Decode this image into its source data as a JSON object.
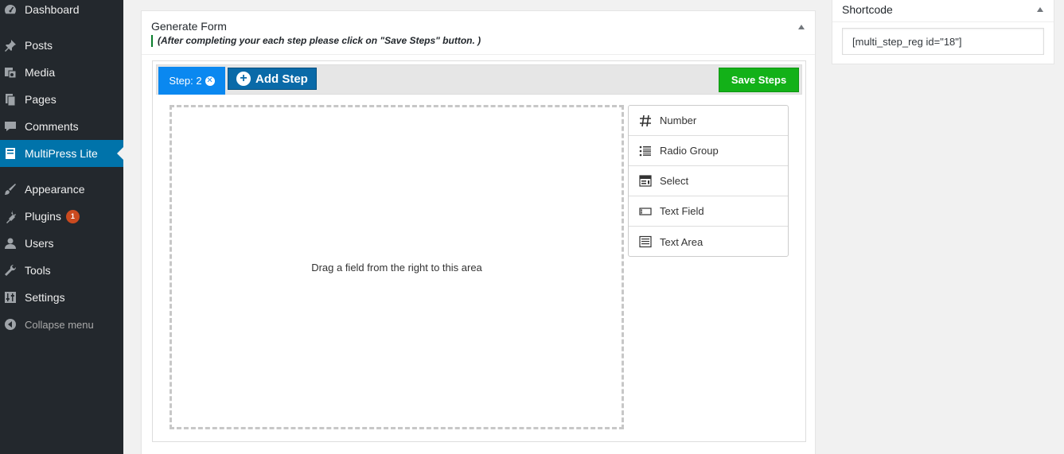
{
  "sidebar": {
    "items": [
      {
        "label": "Dashboard",
        "icon": "dashboard-icon"
      },
      {
        "label": "Posts",
        "icon": "pin-icon"
      },
      {
        "label": "Media",
        "icon": "media-icon"
      },
      {
        "label": "Pages",
        "icon": "pages-icon"
      },
      {
        "label": "Comments",
        "icon": "comment-icon"
      },
      {
        "label": "MultiPress Lite",
        "icon": "book-icon",
        "current": true
      },
      {
        "label": "Appearance",
        "icon": "brush-icon"
      },
      {
        "label": "Plugins",
        "icon": "plugin-icon",
        "badge": "1"
      },
      {
        "label": "Users",
        "icon": "user-icon"
      },
      {
        "label": "Tools",
        "icon": "wrench-icon"
      },
      {
        "label": "Settings",
        "icon": "sliders-icon"
      },
      {
        "label": "Collapse menu",
        "icon": "collapse-icon"
      }
    ]
  },
  "generate_form": {
    "title": "Generate Form",
    "note": "(After completing your each step please click on \"Save Steps\" button. )",
    "step_tab": "Step: 2",
    "add_step": "Add Step",
    "save_steps": "Save Steps",
    "dropzone_text": "Drag a field from the right to this area",
    "fields": [
      {
        "label": "Number",
        "icon": "hash-icon"
      },
      {
        "label": "Radio Group",
        "icon": "radio-group-icon"
      },
      {
        "label": "Select",
        "icon": "select-icon"
      },
      {
        "label": "Text Field",
        "icon": "text-field-icon"
      },
      {
        "label": "Text Area",
        "icon": "text-area-icon"
      }
    ]
  },
  "shortcode": {
    "title": "Shortcode",
    "value": "[multi_step_reg id=\"18\"]"
  },
  "colors": {
    "sidebar_bg": "#23282d",
    "current_menu": "#0073aa",
    "step_tab": "#0a88f0",
    "add_step": "#0a6aa8",
    "save_steps": "#13b118",
    "plugin_badge": "#ca4a1f"
  }
}
